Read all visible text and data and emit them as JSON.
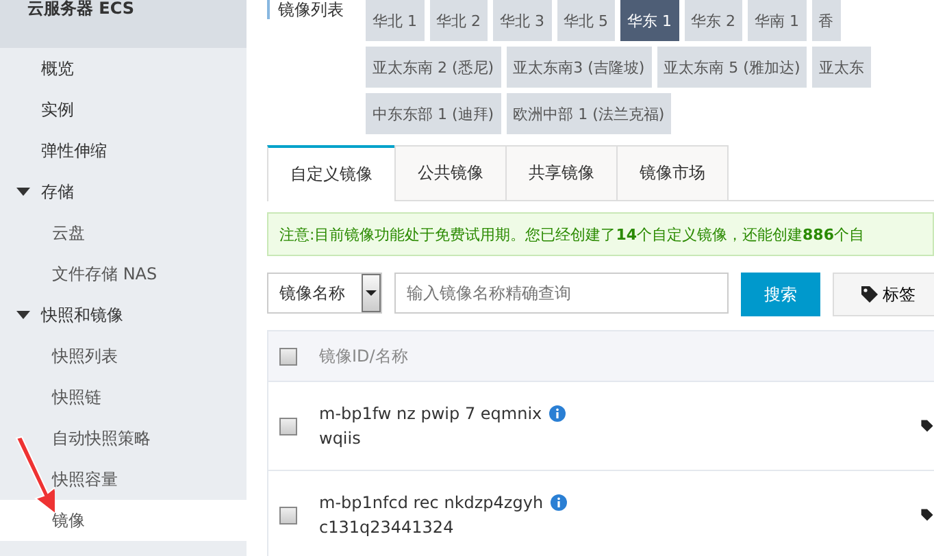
{
  "sidebar": {
    "title": "云服务器 ECS",
    "items": [
      {
        "label": "概览",
        "selected": false
      },
      {
        "label": "实例",
        "selected": false
      },
      {
        "label": "弹性伸缩",
        "selected": false
      },
      {
        "label": "存储",
        "expanded": true,
        "children": [
          {
            "label": "云盘",
            "selected": false
          },
          {
            "label": "文件存储 NAS",
            "selected": false
          }
        ]
      },
      {
        "label": "快照和镜像",
        "expanded": true,
        "children": [
          {
            "label": "快照列表",
            "selected": false
          },
          {
            "label": "快照链",
            "selected": false
          },
          {
            "label": "自动快照策略",
            "selected": false
          },
          {
            "label": "快照容量",
            "selected": false
          },
          {
            "label": "镜像",
            "selected": true
          }
        ]
      }
    ]
  },
  "region_filter": {
    "label": "镜像列表",
    "rows": [
      {
        "buttons": [
          {
            "label": "华北 1",
            "selected": false
          },
          {
            "label": "华北 2",
            "selected": false
          },
          {
            "label": "华北 3",
            "selected": false
          },
          {
            "label": "华北 5",
            "selected": false
          },
          {
            "label": "华东 1",
            "selected": true
          },
          {
            "label": "华东 2",
            "selected": false
          },
          {
            "label": "华南 1",
            "selected": false
          },
          {
            "label": "香",
            "selected": false
          }
        ]
      },
      {
        "buttons": [
          {
            "label": "亚太东南 2 (悉尼)",
            "selected": false
          },
          {
            "label": "亚太东南3 (吉隆坡)",
            "selected": false
          },
          {
            "label": "亚太东南 5 (雅加达)",
            "selected": false
          },
          {
            "label": "亚太东",
            "selected": false
          }
        ]
      },
      {
        "buttons": [
          {
            "label": "中东东部 1 (迪拜)",
            "selected": false
          },
          {
            "label": "欧洲中部 1 (法兰克福)",
            "selected": false
          }
        ]
      }
    ]
  },
  "tabs": [
    {
      "label": "自定义镜像",
      "selected": true
    },
    {
      "label": "公共镜像",
      "selected": false
    },
    {
      "label": "共享镜像",
      "selected": false
    },
    {
      "label": "镜像市场",
      "selected": false
    }
  ],
  "notice": "注意:目前镜像功能处于免费试用期。您已经创建了**14**个自定义镜像，还能创建**886**个自",
  "search": {
    "field_type": "镜像名称",
    "placeholder": "输入镜像名称精确查询",
    "search_button": "搜索",
    "tag_button": "标签"
  },
  "table": {
    "columns": [
      "镜像ID/名称"
    ],
    "all_checked": false,
    "rows": [
      {
        "id": "m-bp1fw nz pwip 7 eqmnix",
        "name": "wqiis",
        "checked": false
      },
      {
        "id": "m-bp1nfcd rec nkdzp4zgyh",
        "name": "c131q23441324",
        "checked": false
      }
    ]
  }
}
